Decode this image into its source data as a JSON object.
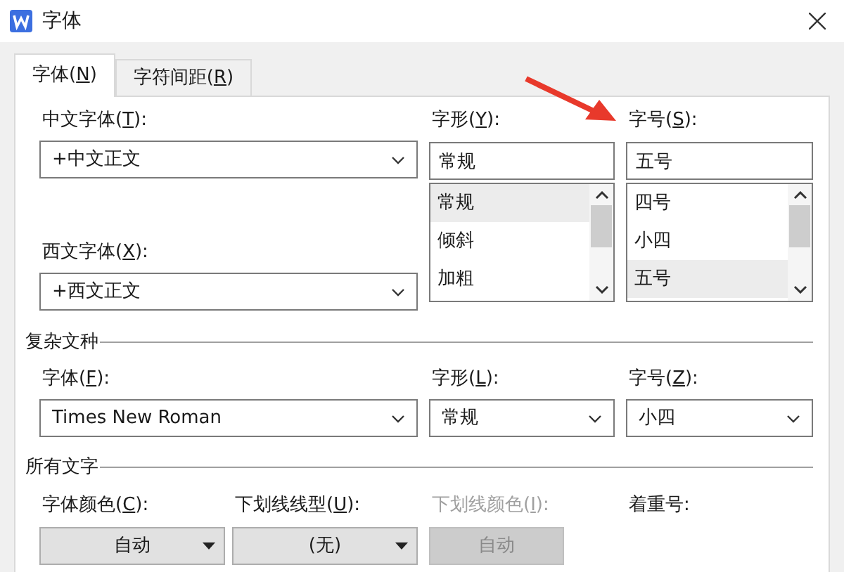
{
  "window": {
    "title": "字体"
  },
  "tabs": [
    {
      "label": "字体(",
      "key": "N",
      "end": ")",
      "selected": true
    },
    {
      "label": "字符间距(",
      "key": "R",
      "end": ")",
      "selected": false
    }
  ],
  "font": {
    "chinese_font": {
      "label": "中文字体(",
      "key": "T",
      "end": "):",
      "value": "+中文正文"
    },
    "western_font": {
      "label": "西文字体(",
      "key": "X",
      "end": "):",
      "value": "+西文正文"
    },
    "style": {
      "label": "字形(",
      "key": "Y",
      "end": "):",
      "value": "常规",
      "options": [
        {
          "text": "常规",
          "selected": true
        },
        {
          "text": "倾斜",
          "selected": false
        },
        {
          "text": "加粗",
          "selected": false
        }
      ]
    },
    "size": {
      "label": "字号(",
      "key": "S",
      "end": "):",
      "value": "五号",
      "options": [
        {
          "text": "四号",
          "selected": false
        },
        {
          "text": "小四",
          "selected": false
        },
        {
          "text": "五号",
          "selected": true
        }
      ]
    }
  },
  "complex_script": {
    "heading": "复杂文种",
    "fields": [
      {
        "label": "字体(",
        "key": "F",
        "end": "):",
        "value": "Times New Roman"
      },
      {
        "label": "字形(",
        "key": "L",
        "end": "):",
        "value": "常规"
      },
      {
        "label": "字号(",
        "key": "Z",
        "end": "):",
        "value": "小四"
      }
    ]
  },
  "all_text": {
    "heading": "所有文字",
    "buttons": [
      {
        "label": "字体颜色(",
        "key": "C",
        "end": "):",
        "value": "自动",
        "disabled": false
      },
      {
        "label": "下划线线型(",
        "key": "U",
        "end": "):",
        "value": "(无)",
        "disabled": false
      },
      {
        "label": "下划线颜色(",
        "key": "I",
        "end": "):",
        "value": "自动",
        "disabled": true
      }
    ],
    "emphasis": {
      "label": "着重号:"
    }
  }
}
